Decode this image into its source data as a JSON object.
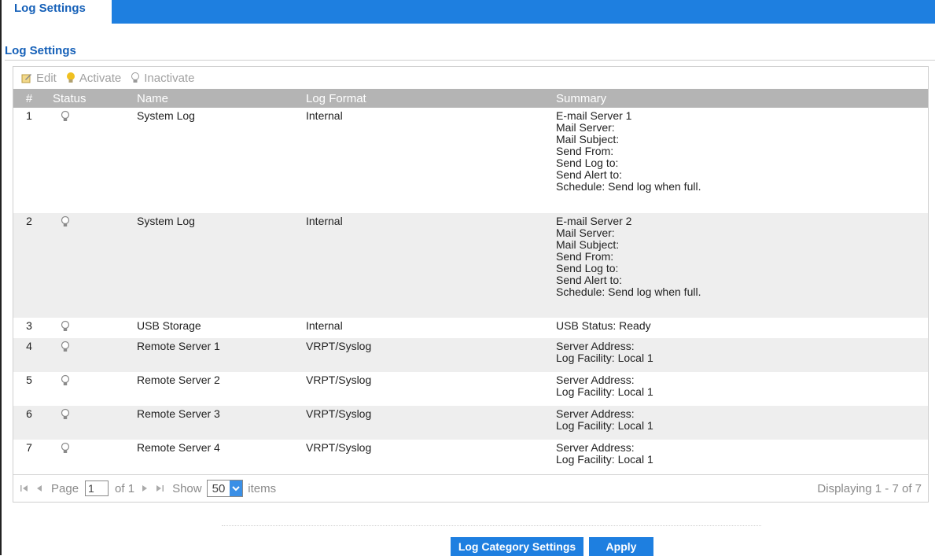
{
  "tab": {
    "label": "Log Settings"
  },
  "section": {
    "title": "Log Settings"
  },
  "toolbar": {
    "edit": "Edit",
    "activate": "Activate",
    "inactivate": "Inactivate"
  },
  "table": {
    "headers": {
      "num": "#",
      "status": "Status",
      "name": "Name",
      "format": "Log Format",
      "summary": "Summary"
    },
    "rows": [
      {
        "num": "1",
        "name": "System Log",
        "format": "Internal",
        "summary": [
          "E-mail Server 1",
          "Mail Server:",
          "Mail Subject:",
          "Send From:",
          "Send Log to:",
          "Send Alert to:",
          "Schedule: Send log when full."
        ]
      },
      {
        "num": "2",
        "name": "System Log",
        "format": "Internal",
        "summary": [
          "E-mail Server 2",
          "Mail Server:",
          "Mail Subject:",
          "Send From:",
          "Send Log to:",
          "Send Alert to:",
          "Schedule: Send log when full."
        ]
      },
      {
        "num": "3",
        "name": "USB Storage",
        "format": "Internal",
        "summary": [
          "USB Status: Ready"
        ]
      },
      {
        "num": "4",
        "name": "Remote Server 1",
        "format": "VRPT/Syslog",
        "summary": [
          "Server Address:",
          "Log Facility: Local 1"
        ]
      },
      {
        "num": "5",
        "name": "Remote Server 2",
        "format": "VRPT/Syslog",
        "summary": [
          "Server Address:",
          "Log Facility: Local 1"
        ]
      },
      {
        "num": "6",
        "name": "Remote Server 3",
        "format": "VRPT/Syslog",
        "summary": [
          "Server Address:",
          "Log Facility: Local 1"
        ]
      },
      {
        "num": "7",
        "name": "Remote Server 4",
        "format": "VRPT/Syslog",
        "summary": [
          "Server Address:",
          "Log Facility: Local 1"
        ]
      }
    ]
  },
  "pager": {
    "page_label": "Page",
    "page_value": "1",
    "of_label": "of 1",
    "show_label": "Show",
    "page_size": "50",
    "items_label": "items",
    "display": "Displaying 1 - 7 of 7"
  },
  "buttons": {
    "category": "Log Category Settings",
    "apply": "Apply"
  },
  "colors": {
    "accent": "#1e7fe0",
    "title": "#1560b8",
    "header_bg": "#b4b4b4",
    "activate_icon": "#f0c020"
  },
  "icons": {
    "edit": "edit-icon",
    "activate": "lightbulb-on-icon",
    "inactivate": "lightbulb-off-icon",
    "status": "lightbulb-icon"
  }
}
